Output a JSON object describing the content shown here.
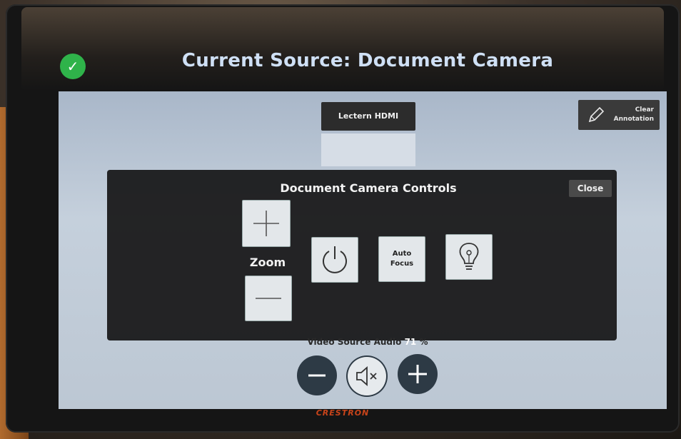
{
  "header": {
    "title": "Current Source: Document Camera",
    "status_icon": "check-icon",
    "status_color": "#2fb34a"
  },
  "sources": {
    "button_label": "Lectern HDMI"
  },
  "annotation": {
    "clear_line1": "Clear",
    "clear_line2": "Annotation",
    "icon": "pencil-icon"
  },
  "doc_camera_panel": {
    "title": "Document Camera Controls",
    "close_label": "Close",
    "zoom_label": "Zoom",
    "zoom_in_icon": "plus-icon",
    "zoom_out_icon": "minus-icon",
    "power_icon": "power-icon",
    "autofocus_line1": "Auto",
    "autofocus_line2": "Focus",
    "lamp_icon": "lightbulb-icon"
  },
  "audio": {
    "label": "Video Source Audio",
    "level": "71",
    "unit": "%",
    "level_color": "#ffffff",
    "vol_down_icon": "minus-icon",
    "mute_icon": "speaker-mute-icon",
    "vol_up_icon": "plus-icon"
  },
  "device": {
    "brand": "CRESTRON",
    "brand_color": "#c8441a"
  }
}
